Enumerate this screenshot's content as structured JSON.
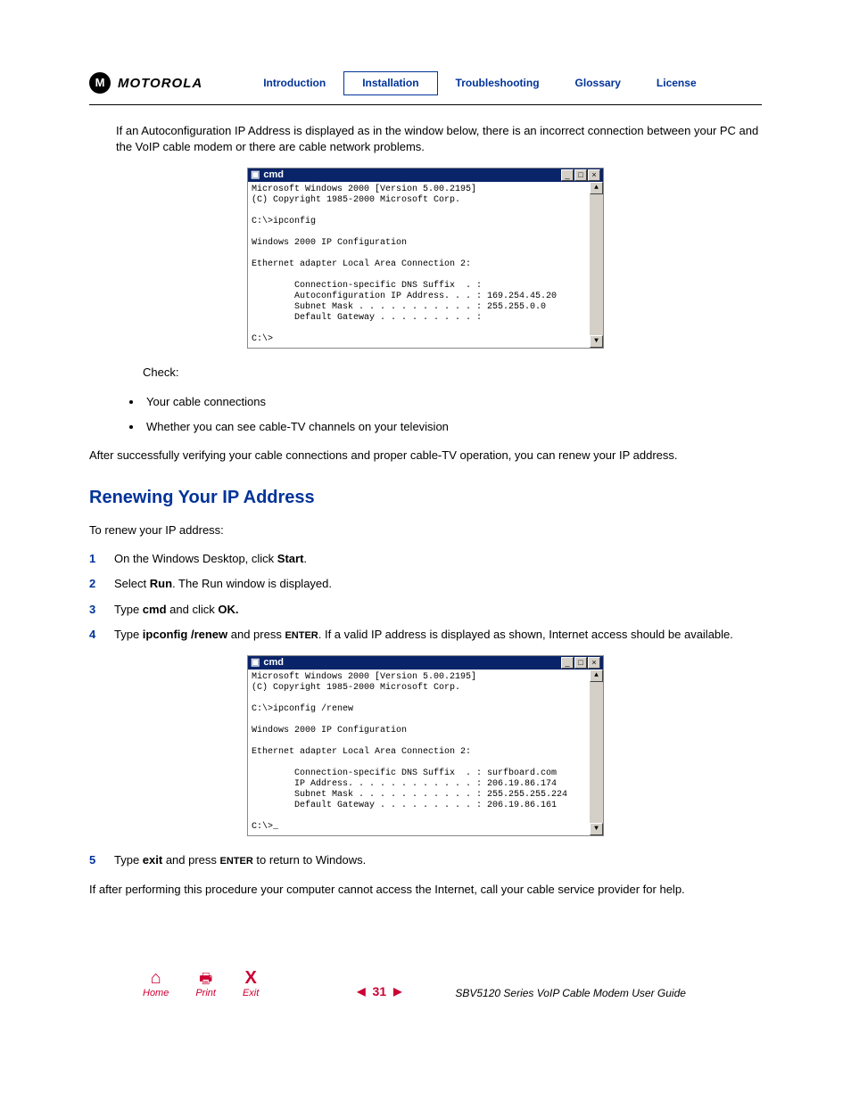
{
  "header": {
    "brand": "MOTOROLA",
    "logo_letter": "M",
    "nav": {
      "intro": "Introduction",
      "install": "Installation",
      "trouble": "Troubleshooting",
      "glossary": "Glossary",
      "license": "License"
    }
  },
  "intro_para": "If an Autoconfiguration IP Address is displayed as in the window below, there is an incorrect connection between your PC and the VoIP cable modem or there are cable network problems.",
  "cmd1": {
    "title": "cmd",
    "content": "Microsoft Windows 2000 [Version 5.00.2195]\n(C) Copyright 1985-2000 Microsoft Corp.\n\nC:\\>ipconfig\n\nWindows 2000 IP Configuration\n\nEthernet adapter Local Area Connection 2:\n\n        Connection-specific DNS Suffix  . :\n        Autoconfiguration IP Address. . . : 169.254.45.20\n        Subnet Mask . . . . . . . . . . . : 255.255.0.0\n        Default Gateway . . . . . . . . . :\n\nC:\\>"
  },
  "check_label": "Check:",
  "check_items": {
    "a": "Your cable connections",
    "b": "Whether you can see cable-TV channels on your television"
  },
  "after_check": "After successfully verifying your cable connections and proper cable-TV operation, you can renew your IP address.",
  "section_title": "Renewing Your IP Address",
  "renew_intro": "To renew your IP address:",
  "steps": {
    "s1a": "On the Windows Desktop, click ",
    "s1b": "Start",
    "s1c": ".",
    "s2a": "Select ",
    "s2b": "Run",
    "s2c": ". The Run window is displayed.",
    "s3a": "Type ",
    "s3b": "cmd",
    "s3c": " and click ",
    "s3d": "OK.",
    "s4a": "Type ",
    "s4b": "ipconfig /renew",
    "s4c": " and press ",
    "s4d": "ENTER",
    "s4e": ". If a valid IP address is displayed as shown, Internet access should be available.",
    "s5a": "Type ",
    "s5b": "exit",
    "s5c": " and press ",
    "s5d": "ENTER",
    "s5e": " to return to Windows."
  },
  "cmd2": {
    "title": "cmd",
    "content": "Microsoft Windows 2000 [Version 5.00.2195]\n(C) Copyright 1985-2000 Microsoft Corp.\n\nC:\\>ipconfig /renew\n\nWindows 2000 IP Configuration\n\nEthernet adapter Local Area Connection 2:\n\n        Connection-specific DNS Suffix  . : surfboard.com\n        IP Address. . . . . . . . . . . . : 206.19.86.174\n        Subnet Mask . . . . . . . . . . . : 255.255.255.224\n        Default Gateway . . . . . . . . . : 206.19.86.161\n\nC:\\>_"
  },
  "closing": "If after performing this procedure your computer cannot access the Internet, call your cable service provider for help.",
  "footer": {
    "home": "Home",
    "print": "Print",
    "exit": "Exit",
    "page": "31",
    "guide": "SBV5120 Series VoIP Cable Modem User Guide"
  }
}
